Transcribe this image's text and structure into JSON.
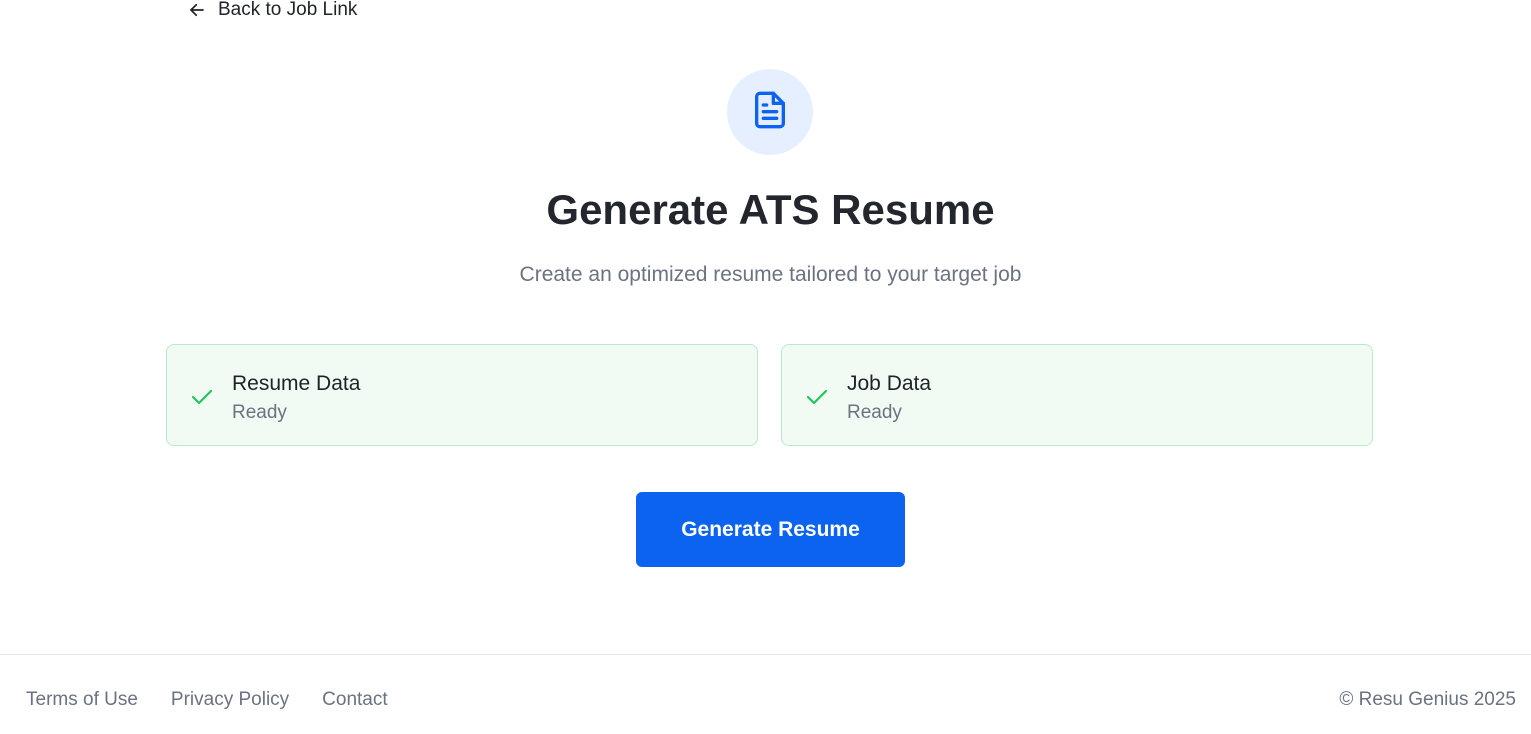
{
  "nav": {
    "back_label": "Back to Job Link"
  },
  "hero": {
    "icon": "file-text-icon",
    "title": "Generate ATS Resume",
    "subtitle": "Create an optimized resume tailored to your target job"
  },
  "status_cards": [
    {
      "label": "Resume Data",
      "status": "Ready",
      "icon": "check-icon"
    },
    {
      "label": "Job Data",
      "status": "Ready",
      "icon": "check-icon"
    }
  ],
  "actions": {
    "generate_label": "Generate Resume"
  },
  "footer": {
    "links": [
      "Terms of Use",
      "Privacy Policy",
      "Contact"
    ],
    "copyright": "© Resu Genius 2025"
  },
  "colors": {
    "primary": "#0b63f0",
    "icon_bg": "#e6efff",
    "success": "#22c55e",
    "card_bg": "#f1fbf4",
    "card_border": "#b5ebc8",
    "muted_text": "#6b7280"
  }
}
